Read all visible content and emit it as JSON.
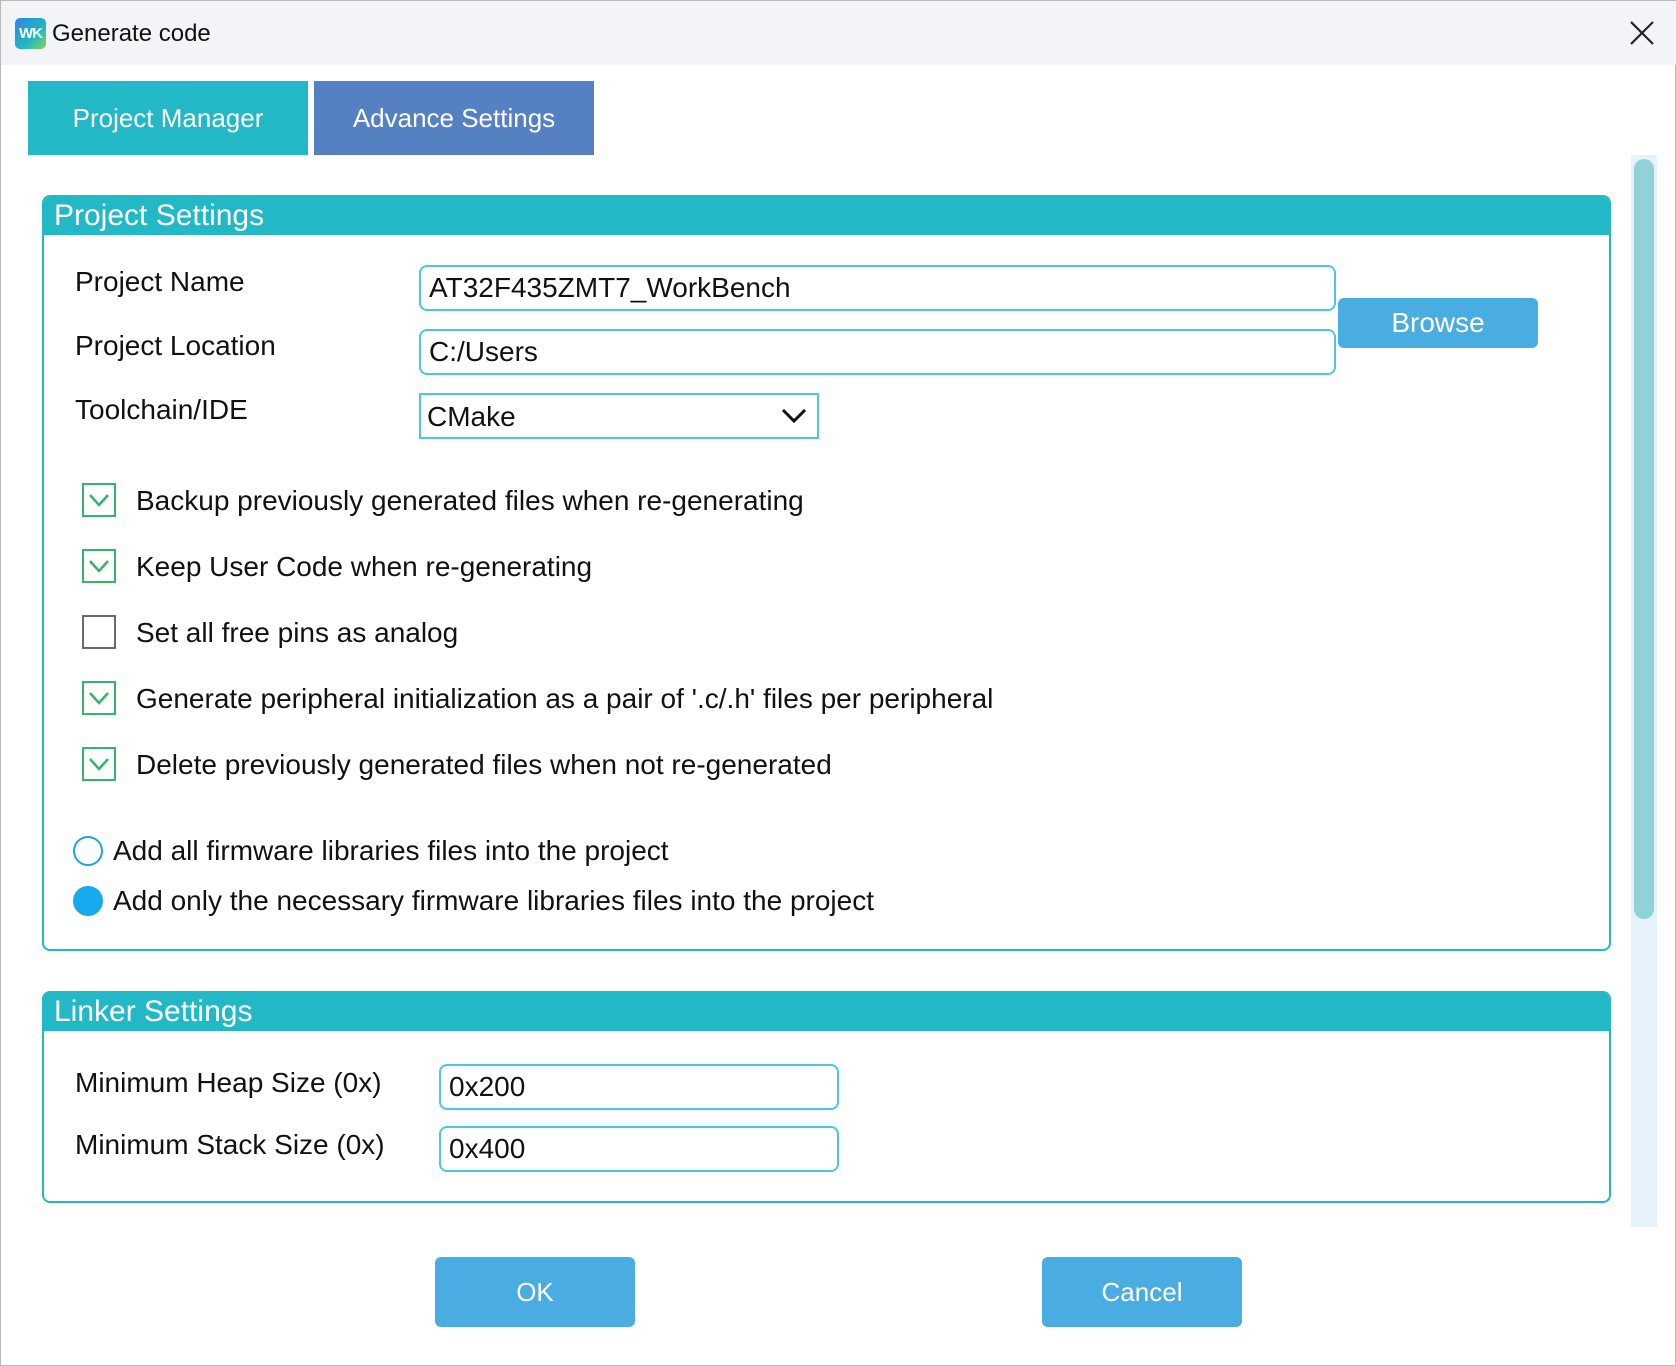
{
  "window": {
    "logo_text": "WK",
    "title": "Generate code"
  },
  "tabs": [
    {
      "label": "Project Manager",
      "active": true
    },
    {
      "label": "Advance Settings",
      "active": false
    }
  ],
  "project_settings": {
    "header": "Project Settings",
    "project_name": {
      "label": "Project Name",
      "value": "AT32F435ZMT7_WorkBench"
    },
    "project_location": {
      "label": "Project Location",
      "value": "C:/Users"
    },
    "browse_label": "Browse",
    "toolchain": {
      "label": "Toolchain/IDE",
      "selected": "CMake"
    },
    "checkboxes": [
      {
        "label": "Backup previously generated files when re-generating",
        "checked": true
      },
      {
        "label": "Keep User Code when re-generating",
        "checked": true
      },
      {
        "label": "Set all free pins as analog",
        "checked": false
      },
      {
        "label": "Generate peripheral initialization as a pair of '.c/.h' files per peripheral",
        "checked": true
      },
      {
        "label": "Delete previously generated files when not re-generated",
        "checked": true
      }
    ],
    "radios": [
      {
        "label": "Add all firmware libraries files into the project",
        "selected": false
      },
      {
        "label": "Add only the necessary firmware libraries files into the project",
        "selected": true
      }
    ]
  },
  "linker_settings": {
    "header": "Linker Settings",
    "heap": {
      "label": "Minimum Heap Size (0x)",
      "value": "0x200"
    },
    "stack": {
      "label": "Minimum Stack Size (0x)",
      "value": "0x400"
    }
  },
  "footer": {
    "ok_label": "OK",
    "cancel_label": "Cancel"
  },
  "colors": {
    "accent_teal": "#23b8c6",
    "tab_inactive": "#5581c2",
    "button_blue": "#4aade2",
    "input_border": "#4cc5e6",
    "check_green": "#35b56a",
    "radio_blue": "#17a9ec"
  }
}
